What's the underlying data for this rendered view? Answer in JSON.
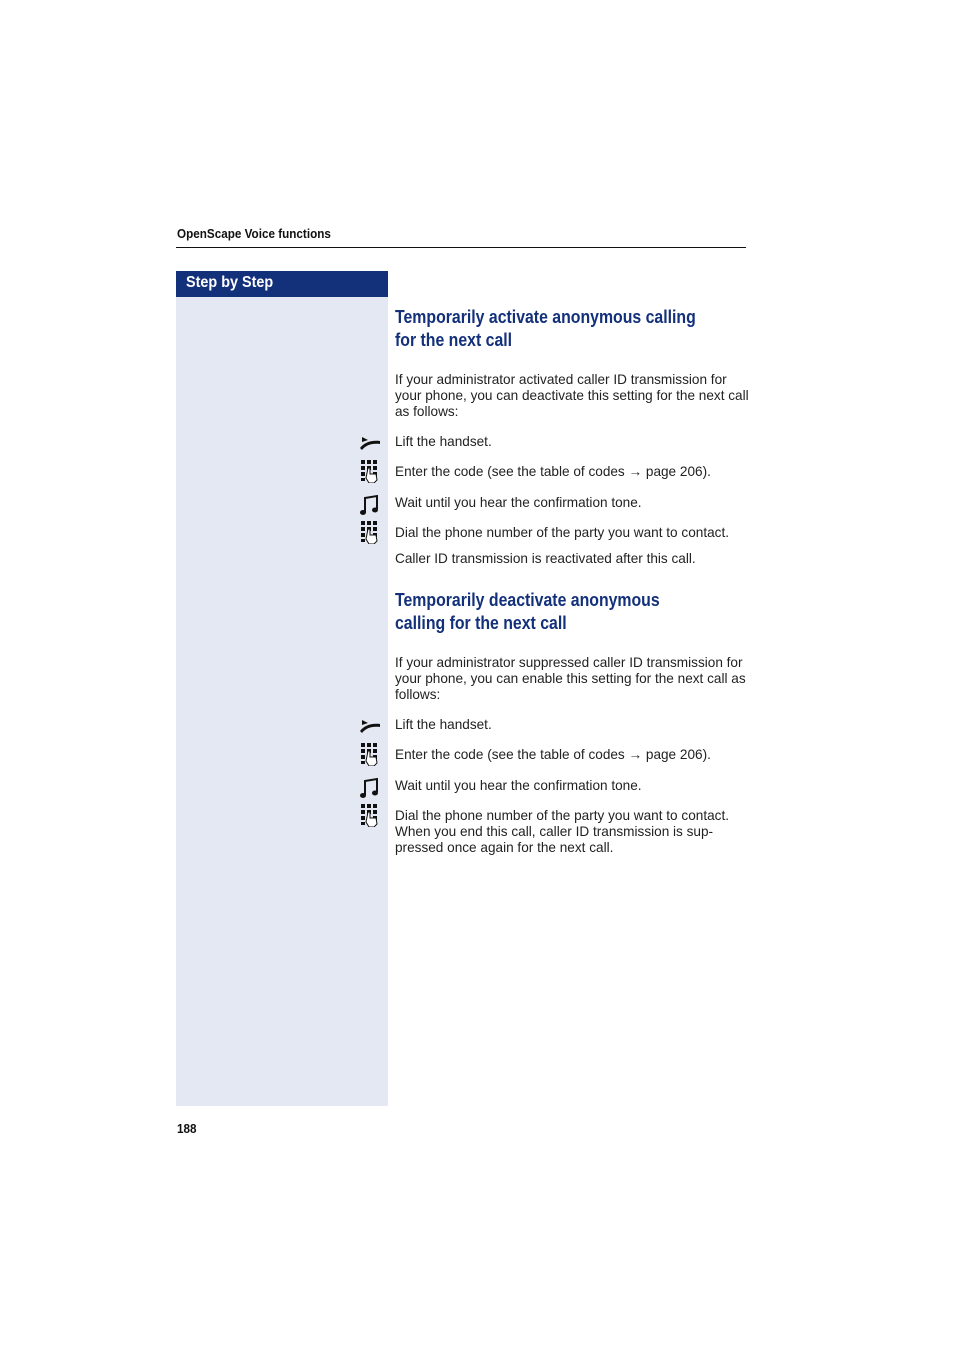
{
  "header": {
    "section_title": "OpenScape Voice functions"
  },
  "sidebar": {
    "title": "Step by Step"
  },
  "sections": [
    {
      "heading": "Temporarily activate anonymous calling for the next call",
      "intro": "If your administrator activated caller ID transmission for your phone, you can deactivate this setting for the next call as follows:",
      "steps": [
        {
          "icon": "lift-handset-icon",
          "text": "Lift the handset."
        },
        {
          "icon": "keypad-icon",
          "text": "Enter the code (see the table of codes → page 206)."
        },
        {
          "icon": "tone-icon",
          "text": "Wait until you hear the confirmation tone."
        },
        {
          "icon": "keypad-icon",
          "text": "Dial the phone number of the party you want to contact."
        }
      ],
      "note": "Caller ID transmission is reactivated after this call."
    },
    {
      "heading": "Temporarily deactivate anonymous calling for the next call",
      "intro": "If your administrator suppressed caller ID transmission for your phone, you can enable this setting for the next call as follows:",
      "steps": [
        {
          "icon": "lift-handset-icon",
          "text": "Lift the handset."
        },
        {
          "icon": "keypad-icon",
          "text": "Enter the code (see the table of codes → page 206)."
        },
        {
          "icon": "tone-icon",
          "text": "Wait until you hear the confirmation tone."
        },
        {
          "icon": "keypad-icon",
          "text": "Dial the phone number of the party you want to contact. When you end this call, caller ID transmission is sup-pressed once again for the next call."
        }
      ]
    }
  ],
  "footer": {
    "page_number": "188"
  }
}
